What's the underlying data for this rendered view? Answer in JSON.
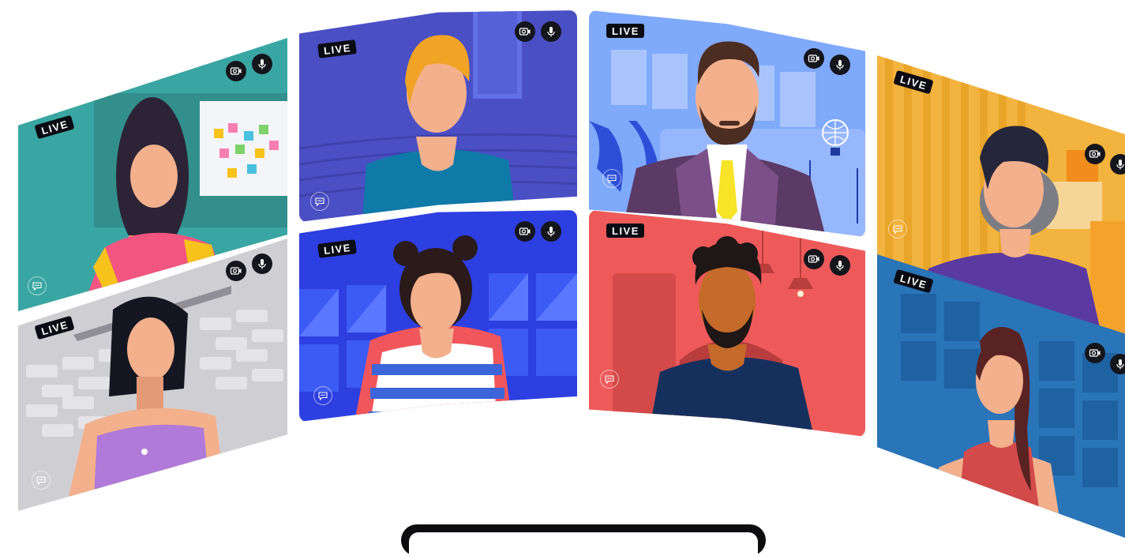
{
  "tiles": [
    {
      "id": "participant-1",
      "live_label": "LIVE",
      "bg": "#3aa6a3",
      "hair": "#2c2436",
      "shirt": "#f2557f",
      "accent": "#f7c21b"
    },
    {
      "id": "participant-2",
      "live_label": "LIVE",
      "bg": "#cfcfd3",
      "hair": "#141722",
      "shirt": "#b07ad8",
      "accent": "#ffffff"
    },
    {
      "id": "participant-3",
      "live_label": "LIVE",
      "bg": "#4a4fc4",
      "hair": "#f0a325",
      "shirt": "#0f7aa8",
      "accent": "#6370e8"
    },
    {
      "id": "participant-4",
      "live_label": "LIVE",
      "bg": "#2d3fe0",
      "hair": "#2b1a1a",
      "shirt": "#f0565b",
      "accent": "#3c5af4"
    },
    {
      "id": "participant-5",
      "live_label": "LIVE",
      "bg": "#7fa9fb",
      "hair": "#4b2d22",
      "shirt": "#5b3a66",
      "accent": "#f7e327"
    },
    {
      "id": "participant-6",
      "live_label": "LIVE",
      "bg": "#ee5a5a",
      "hair": "#1f1616",
      "shirt": "#16305e",
      "accent": "#b83d3d"
    },
    {
      "id": "participant-7",
      "live_label": "LIVE",
      "bg": "#f3b33f",
      "hair": "#26263a",
      "shirt": "#5a3aa0",
      "accent": "#e9a52a"
    },
    {
      "id": "participant-8",
      "live_label": "LIVE",
      "bg": "#2a74b8",
      "hair": "#5a2323",
      "shirt": "#d24a4a",
      "accent": "#1f62a2"
    }
  ],
  "icons": {
    "camera": "camera-icon",
    "mic": "microphone-icon",
    "chat": "chat-bubble-icon"
  }
}
